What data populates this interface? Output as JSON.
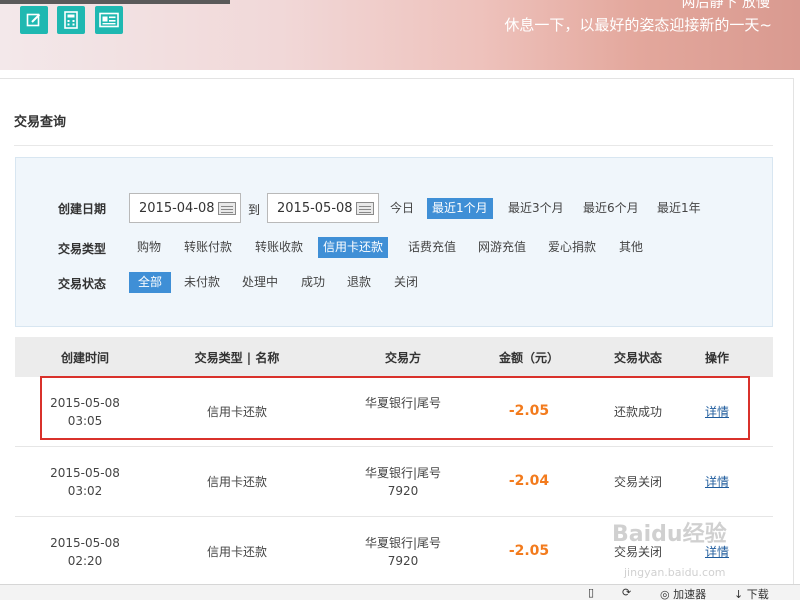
{
  "banner": {
    "tagline_top": "两后静下 放慢",
    "tagline": "休息一下，以最好的姿态迎接新的一天~",
    "icons": [
      "edit-icon",
      "calculator-icon",
      "id-card-icon"
    ]
  },
  "page": {
    "title": "交易查询"
  },
  "filters": {
    "date": {
      "label": "创建日期",
      "start": "2015-04-08",
      "to_label": "到",
      "end": "2015-05-08",
      "quick": [
        {
          "label": "今日",
          "active": false
        },
        {
          "label": "最近1个月",
          "active": true
        },
        {
          "label": "最近3个月",
          "active": false
        },
        {
          "label": "最近6个月",
          "active": false
        },
        {
          "label": "最近1年",
          "active": false
        }
      ]
    },
    "type": {
      "label": "交易类型",
      "options": [
        {
          "label": "购物",
          "active": false
        },
        {
          "label": "转账付款",
          "active": false
        },
        {
          "label": "转账收款",
          "active": false
        },
        {
          "label": "信用卡还款",
          "active": true
        },
        {
          "label": "话费充值",
          "active": false
        },
        {
          "label": "网游充值",
          "active": false
        },
        {
          "label": "爱心捐款",
          "active": false
        },
        {
          "label": "其他",
          "active": false
        }
      ]
    },
    "status": {
      "label": "交易状态",
      "options": [
        {
          "label": "全部",
          "active": true
        },
        {
          "label": "未付款",
          "active": false
        },
        {
          "label": "处理中",
          "active": false
        },
        {
          "label": "成功",
          "active": false
        },
        {
          "label": "退款",
          "active": false
        },
        {
          "label": "关闭",
          "active": false
        }
      ]
    }
  },
  "table": {
    "columns": [
      "创建时间",
      "交易类型 | 名称",
      "交易方",
      "金额（元）",
      "交易状态",
      "操作"
    ],
    "rows": [
      {
        "date": "2015-05-08",
        "time": "03:05",
        "type": "信用卡还款",
        "party": "华夏银行|尾号",
        "party_tail": "",
        "amount": "-2.05",
        "status": "还款成功",
        "action": "详情"
      },
      {
        "date": "2015-05-08",
        "time": "03:02",
        "type": "信用卡还款",
        "party": "华夏银行|尾号",
        "party_tail": "7920",
        "amount": "-2.04",
        "status": "交易关闭",
        "action": "详情"
      },
      {
        "date": "2015-05-08",
        "time": "02:20",
        "type": "信用卡还款",
        "party": "华夏银行|尾号",
        "party_tail": "7920",
        "amount": "-2.05",
        "status": "交易关闭",
        "action": "详情"
      }
    ]
  },
  "statusbar": {
    "accelerator": "加速器",
    "download": "下载"
  },
  "watermark": {
    "line1": "Baidu经验",
    "line2": "jingyan.baidu.com"
  },
  "colors": {
    "accent": "#3f8fd6",
    "amount": "#f37b1d",
    "highlight": "#d9312b",
    "link": "#1f5c9d",
    "icon_bg": "#1fb8b1"
  }
}
